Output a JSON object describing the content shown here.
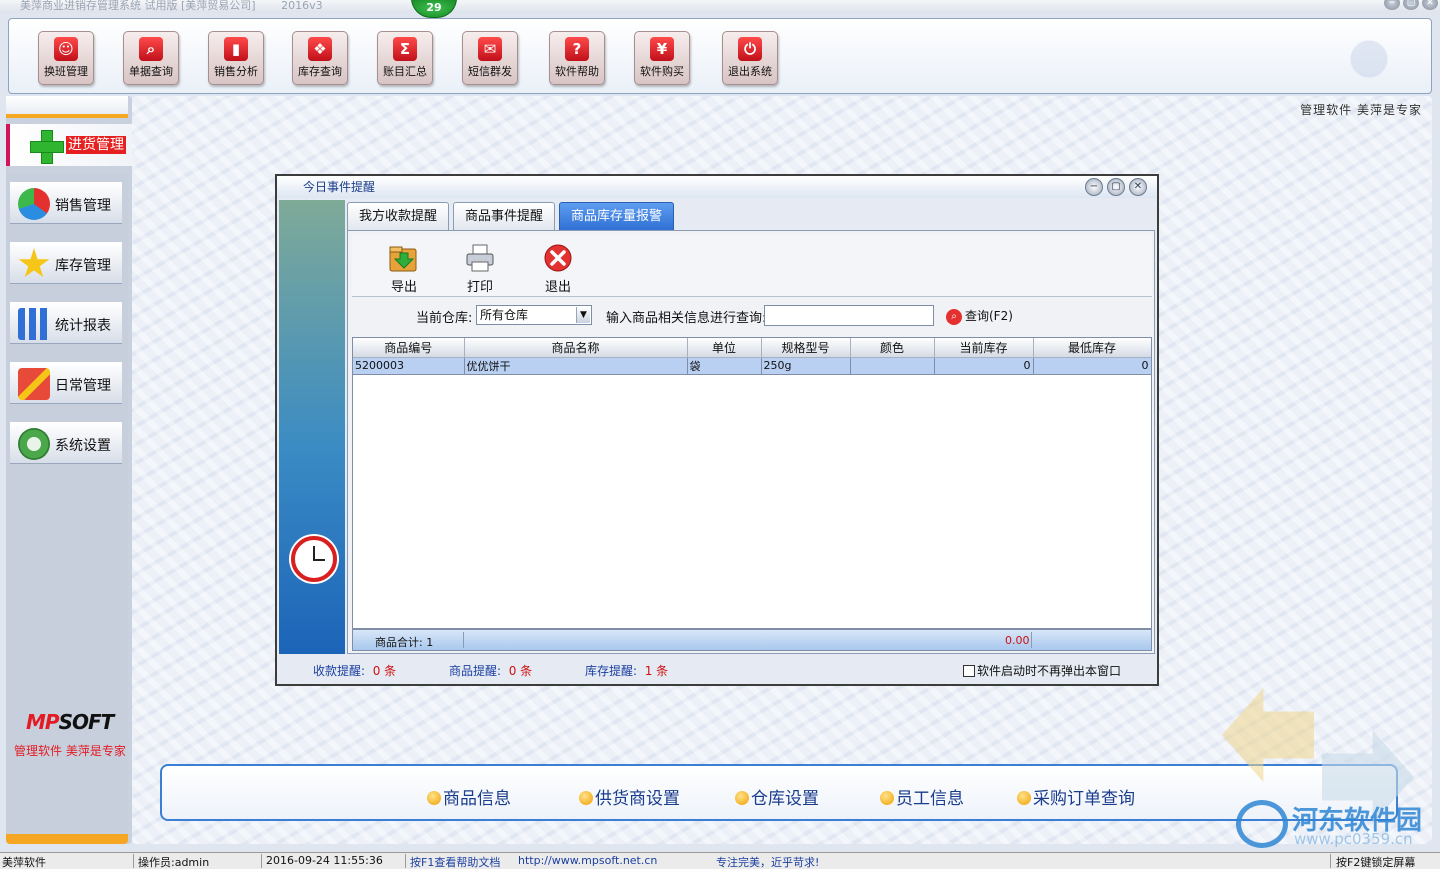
{
  "window": {
    "title": "美萍商业进销存管理系统 试用版 [美萍贸易公司]",
    "version": "2016v3",
    "badge": "29",
    "controls": [
      "−",
      "▢",
      "✕"
    ]
  },
  "toolbar": [
    {
      "label": "换班管理",
      "icon": "users-icon",
      "glyph": "☺",
      "color": "#e84a3a"
    },
    {
      "label": "单据查询",
      "icon": "magnifier-icon",
      "glyph": "⌕",
      "color": "#e84a3a"
    },
    {
      "label": "销售分析",
      "icon": "bar-chart-icon",
      "glyph": "▮",
      "color": "#e84a3a"
    },
    {
      "label": "库存查询",
      "icon": "stack-icon",
      "glyph": "❖",
      "color": "#e84a3a"
    },
    {
      "label": "账目汇总",
      "icon": "sigma-icon",
      "glyph": "Σ",
      "color": "#e84a3a"
    },
    {
      "label": "短信群发",
      "icon": "envelope-icon",
      "glyph": "✉",
      "color": "#e84a3a"
    },
    {
      "label": "软件帮助",
      "icon": "help-icon",
      "glyph": "?",
      "color": "#e84a3a"
    },
    {
      "label": "软件购买",
      "icon": "yen-icon",
      "glyph": "¥",
      "color": "#e84a3a"
    },
    {
      "label": "退出系统",
      "icon": "power-icon",
      "glyph": "⏻",
      "color": "#e84a3a"
    }
  ],
  "sidebar": {
    "active": {
      "label": "进货管理",
      "icon": "plus-icon"
    },
    "items": [
      {
        "label": "销售管理",
        "icon": "pie-chart-icon"
      },
      {
        "label": "库存管理",
        "icon": "star-icon"
      },
      {
        "label": "统计报表",
        "icon": "bar-chart-icon"
      },
      {
        "label": "日常管理",
        "icon": "tools-icon"
      },
      {
        "label": "系统设置",
        "icon": "gear-icon"
      }
    ],
    "brand": {
      "logo_main": "MP",
      "logo_rest": "SOFT",
      "tagline": "管理软件  美萍是专家"
    }
  },
  "main": {
    "tagline": "管理软件  美萍是专家"
  },
  "dialog": {
    "title": "今日事件提醒",
    "controls": [
      "−",
      "▢",
      "✕"
    ],
    "tabs": [
      {
        "label": "我方收款提醒",
        "active": false
      },
      {
        "label": "商品事件提醒",
        "active": false
      },
      {
        "label": "商品库存量报警",
        "active": true
      }
    ],
    "actions": [
      {
        "label": "导出",
        "icon": "export-icon"
      },
      {
        "label": "打印",
        "icon": "printer-icon"
      },
      {
        "label": "退出",
        "icon": "close-icon"
      }
    ],
    "filter": {
      "warehouse_label": "当前仓库:",
      "warehouse_value": "所有仓库",
      "search_label": "输入商品相关信息进行查询:",
      "search_value": "",
      "query_label": "查询(F2)"
    },
    "table": {
      "columns": [
        "商品编号",
        "商品名称",
        "单位",
        "规格型号",
        "颜色",
        "当前库存",
        "最低库存"
      ],
      "rows": [
        [
          "5200003",
          "优优饼干",
          "袋",
          "250g",
          "",
          "0",
          "0"
        ]
      ]
    },
    "footer": {
      "count_label": "商品合计: 1",
      "total": "0.00"
    },
    "status": {
      "receipt_label": "收款提醒:",
      "receipt_value": "0 条",
      "goods_label": "商品提醒:",
      "goods_value": "0 条",
      "stock_label": "库存提醒:",
      "stock_value": "1 条",
      "checkbox_label": "软件启动时不再弹出本窗口",
      "checkbox_checked": false
    }
  },
  "quick_links": [
    "商品信息",
    "供货商设置",
    "仓库设置",
    "员工信息",
    "采购订单查询"
  ],
  "watermark": {
    "text": "河东软件园",
    "url": "www.pc0359.cn"
  },
  "statusbar": {
    "app": "美萍软件",
    "operator": "操作员:admin",
    "datetime": "2016-09-24 11:55:36",
    "help": "按F1查看帮助文档",
    "url": "http://www.mpsoft.net.cn",
    "slogan": "专注完美，近乎苛求!",
    "lock": "按F2键锁定屏幕"
  },
  "colors": {
    "accent": "#2f70d4",
    "sidebar_active": "#e62020",
    "highlight_row": "#b9d0f2",
    "warning": "#d01010"
  }
}
